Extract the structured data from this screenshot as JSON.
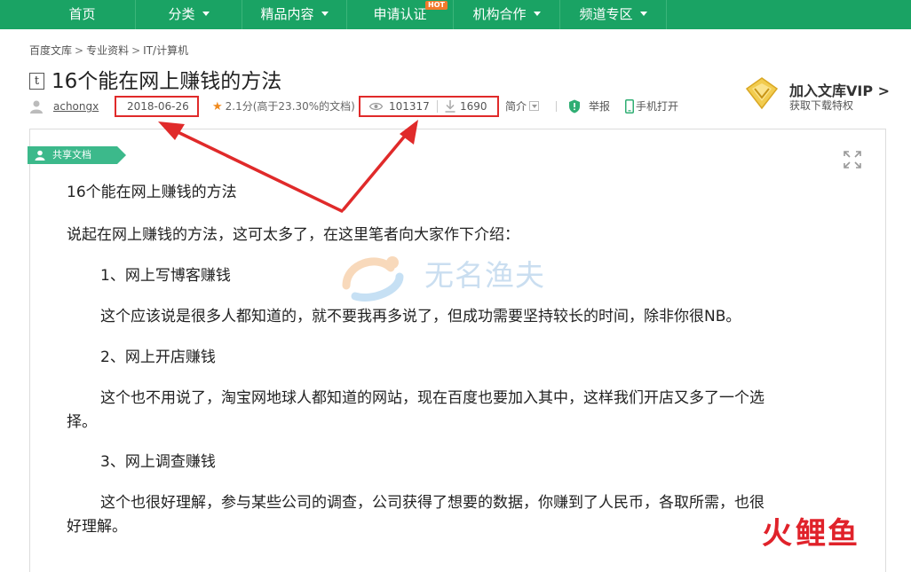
{
  "nav": {
    "items": [
      {
        "label": "首页"
      },
      {
        "label": "分类"
      },
      {
        "label": "精品内容"
      },
      {
        "label": "申请认证",
        "badge": "HOT"
      },
      {
        "label": "机构合作"
      },
      {
        "label": "频道专区"
      }
    ]
  },
  "breadcrumb": [
    "百度文库",
    "专业资料",
    "IT/计算机"
  ],
  "document": {
    "type_icon": "t",
    "title": "16个能在网上赚钱的方法",
    "author": "achongx",
    "date": "2018-06-26",
    "rating": "2.1分(高于23.30%的文档)",
    "views": "101317",
    "downloads": "1690",
    "intro_label": "简介",
    "report_label": "举报",
    "mobile_label": "手机打开",
    "share_tag": "共享文档"
  },
  "vip": {
    "title": "加入文库VIP >",
    "subtitle": "获取下载特权"
  },
  "content": {
    "heading": "16个能在网上赚钱的方法",
    "intro": "说起在网上赚钱的方法，这可太多了，在这里笔者向大家作下介绍：",
    "item1_title": "1、网上写博客赚钱",
    "item1_body": "这个应该说是很多人都知道的，就不要我再多说了，但成功需要坚持较长的时间，除非你很NB。",
    "item2_title": "2、网上开店赚钱",
    "item2_body_line1": "这个也不用说了，淘宝网地球人都知道的网站，现在百度也要加入其中，这样我们开店又多了一个选",
    "item2_body_line2": "择。",
    "item3_title": "3、网上调查赚钱",
    "item3_body_line1": "这个也很好理解，参与某些公司的调查，公司获得了想要的数据，你赚到了人民币，各取所需，也很",
    "item3_body_line2": "好理解。"
  },
  "watermark": {
    "text": "无名渔夫",
    "corner": [
      "火",
      "鲤",
      "鱼"
    ]
  },
  "colors": {
    "nav_green": "#1aa364",
    "tag_green": "#3cb98b",
    "highlight_red": "#e02a2a",
    "star_orange": "#f08a1d"
  }
}
